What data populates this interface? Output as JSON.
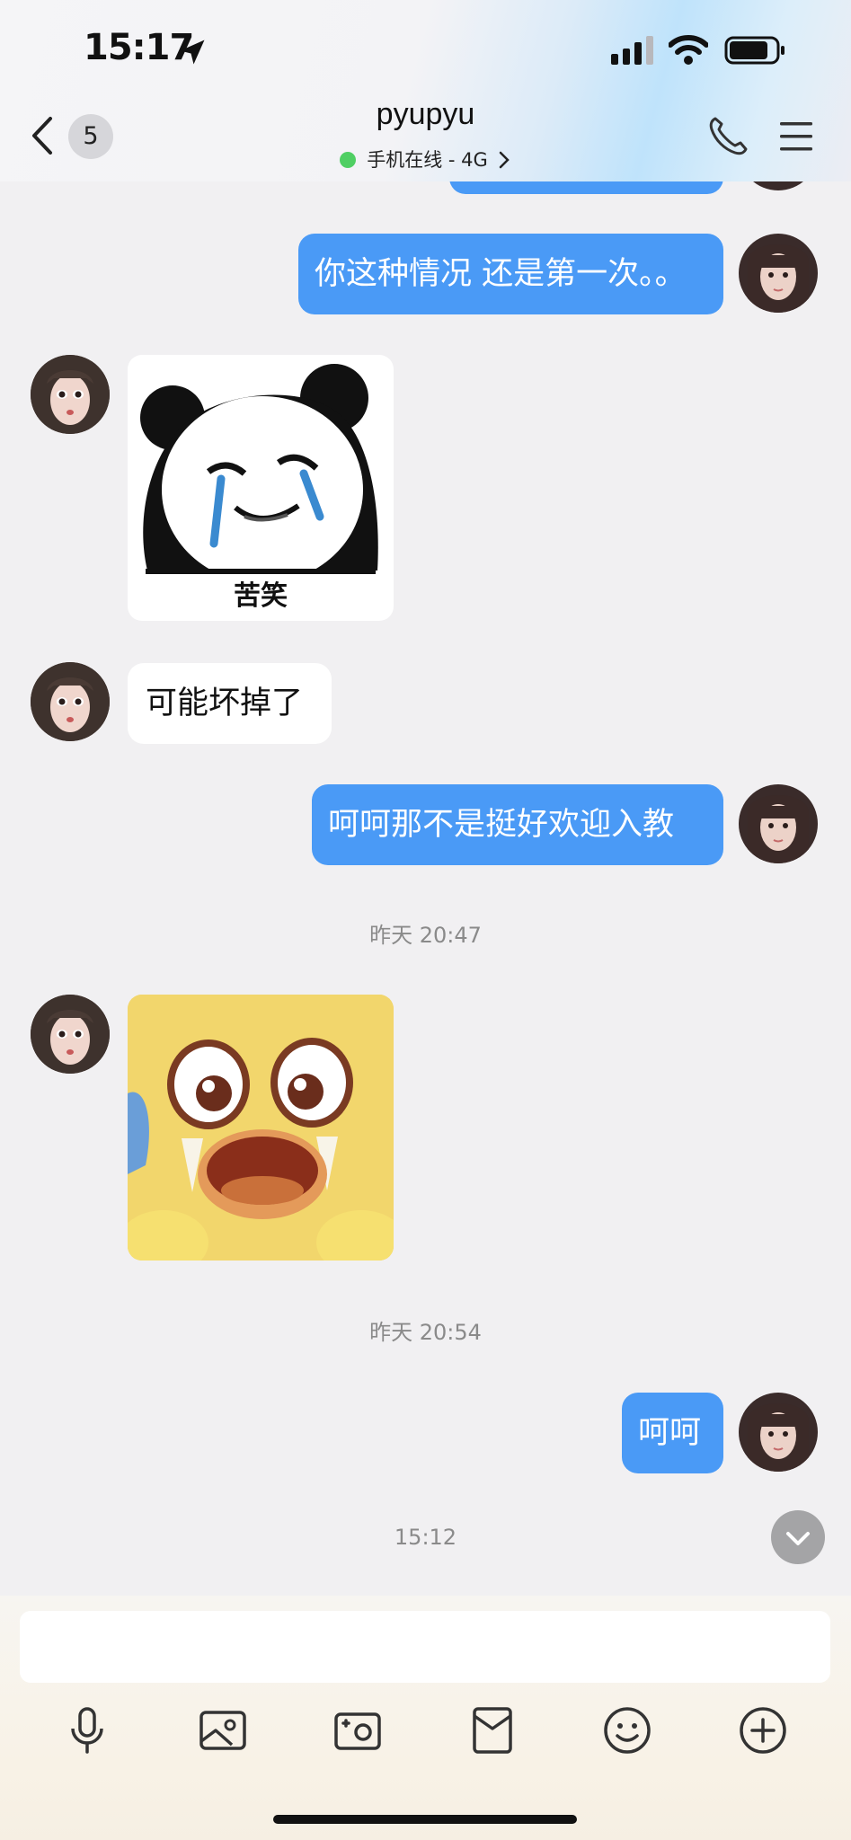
{
  "status_bar": {
    "time": "15:17"
  },
  "header": {
    "unread_count": "5",
    "contact_name": "pyupyu",
    "online_status": "手机在线 - 4G"
  },
  "messages": {
    "m1": "你这种情况 还是第一次。。",
    "sticker1_caption": "苦笑",
    "m2": "可能坏掉了",
    "m3": "呵呵那不是挺好欢迎入教",
    "time1": "昨天 20:47",
    "time2": "昨天 20:54",
    "m4": "呵呵",
    "time3": "15:12"
  },
  "input": {
    "placeholder": ""
  },
  "toolbar": {
    "icons": [
      "microphone-icon",
      "image-icon",
      "camera-icon",
      "red-packet-icon",
      "emoji-icon",
      "plus-icon"
    ]
  },
  "colors": {
    "my_bubble": "#4a9af6",
    "friend_bubble": "#ffffff",
    "online": "#4fcf63"
  }
}
